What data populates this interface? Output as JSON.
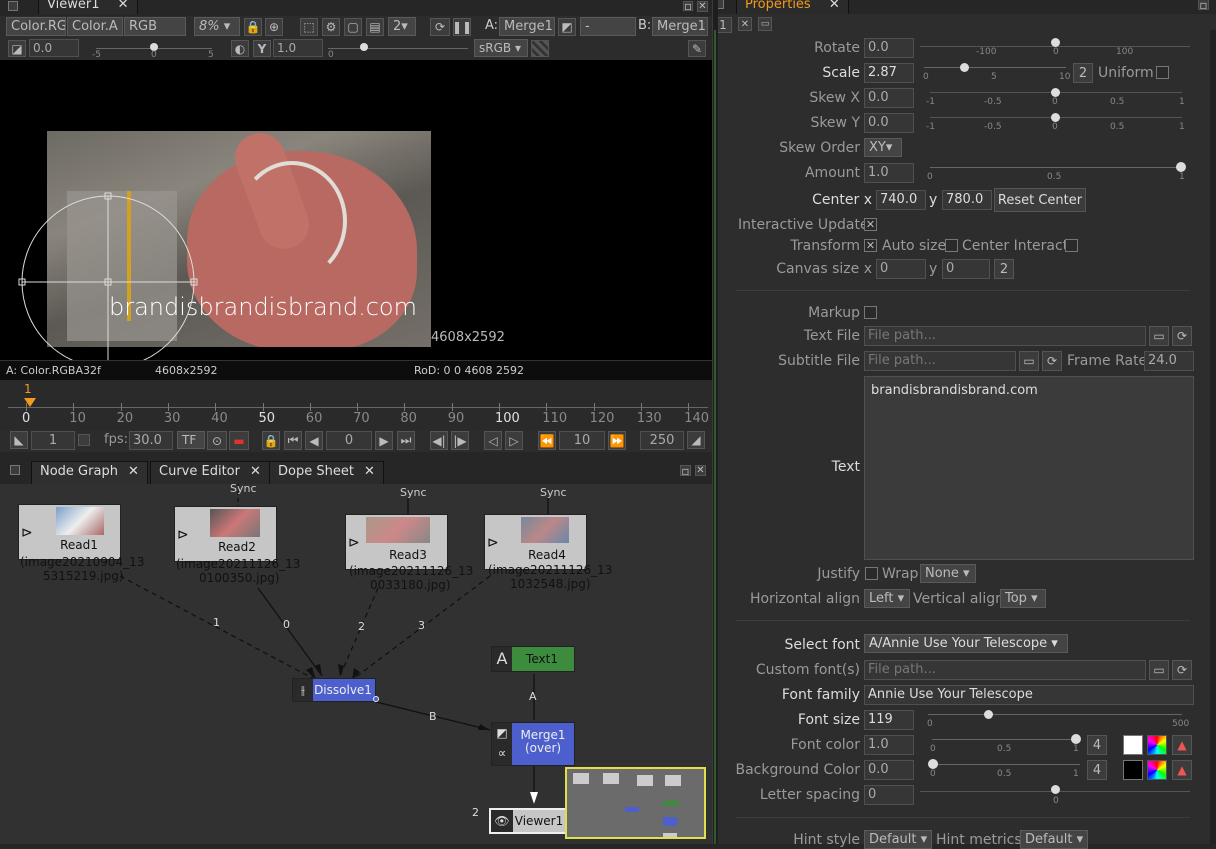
{
  "viewer": {
    "tab": "Viewer1",
    "layer": "Color.RGBA",
    "alpha": "Color.A",
    "channels": "RGB",
    "zoom": "8%",
    "a_label": "A:",
    "a_input": "Merge1",
    "op": "-",
    "b_label": "B:",
    "b_input": "Merge1",
    "proxy": "2",
    "gain": "0.0",
    "gain_ticks": [
      "-5",
      "0",
      "5"
    ],
    "gamma": "1.0",
    "gamma_ticks": [
      "0"
    ],
    "colorspace": "sRGB",
    "overlay_text": "brandisbrandisbrand.com",
    "format": "4608x2592",
    "info_left": "A: Color.RGBA32f",
    "info_format": "4608x2592",
    "info_rod": "RoD: 0 0 4608 2592"
  },
  "timeline": {
    "current_marker": "1",
    "ticks": [
      "0",
      "10",
      "20",
      "30",
      "40",
      "50",
      "60",
      "70",
      "80",
      "90",
      "100",
      "110",
      "120",
      "130",
      "140"
    ],
    "start_frame": "1",
    "fps_label": "fps:",
    "fps": "30.0",
    "tf": "TF",
    "current_frame": "0",
    "step": "10",
    "end_frame": "250"
  },
  "graph_tabs": [
    "Node Graph",
    "Curve Editor",
    "Dope Sheet"
  ],
  "nodes": {
    "read1": [
      "Read1",
      "(image20210904_13",
      "5315219.jpg)"
    ],
    "read2": [
      "Read2",
      "(image20211126_13",
      "0100350.jpg)"
    ],
    "read3": [
      "Read3",
      "(image20211126_13",
      "0033180.jpg)"
    ],
    "read4": [
      "Read4",
      "(image20211126_13",
      "1032548.jpg)"
    ],
    "sync": "Sync",
    "dissolve": "Dissolve1",
    "text": "Text1",
    "merge": [
      "Merge1",
      "(over)"
    ],
    "viewer": "Viewer1",
    "edge_labels": [
      "1",
      "0",
      "2",
      "3",
      "A",
      "B",
      "2"
    ]
  },
  "props": {
    "tab": "Properties",
    "rotate_label": "Rotate",
    "rotate": "0.0",
    "rotate_ticks": [
      "-100",
      "0",
      "100"
    ],
    "scale_label": "Scale",
    "scale": "2.87",
    "scale_ticks": [
      "0",
      "5",
      "10"
    ],
    "scale_dim": "2",
    "uniform": "Uniform",
    "skewx_label": "Skew X",
    "skewx": "0.0",
    "skewy_label": "Skew Y",
    "skewy": "0.0",
    "skew_ticks": [
      "-1",
      "-0.5",
      "0",
      "0.5",
      "1"
    ],
    "skew_order_label": "Skew Order",
    "skew_order": "XY",
    "amount_label": "Amount",
    "amount": "1.0",
    "amount_ticks": [
      "0",
      "0.5",
      "1"
    ],
    "center_label": "Center x",
    "center_x": "740.0",
    "center_y_label": "y",
    "center_y": "780.0",
    "reset_center": "Reset Center",
    "interactive_update": "Interactive Update",
    "transform": "Transform",
    "auto_size": "Auto size",
    "center_interact": "Center Interact",
    "canvas_size": "Canvas size x",
    "canvas_x": "0",
    "canvas_y_label": "y",
    "canvas_y": "0",
    "canvas_dim": "2",
    "markup": "Markup",
    "text_file": "Text File",
    "path_ph": "File path...",
    "subtitle_file": "Subtitle File",
    "frame_rate_label": "Frame Rate",
    "frame_rate": "24.0",
    "text_label": "Text",
    "text_value": "brandisbrandisbrand.com",
    "justify": "Justify",
    "wrap": "Wrap",
    "wrap_value": "None",
    "halign_label": "Horizontal align",
    "halign": "Left",
    "valign_label": "Vertical align",
    "valign": "Top",
    "select_font": "Select font",
    "font": "A/Annie Use Your Telescope",
    "custom_fonts": "Custom font(s)",
    "font_family_label": "Font family",
    "font_family": "Annie Use Your Telescope",
    "font_size_label": "Font size",
    "font_size": "119",
    "font_size_ticks": [
      "0",
      "500"
    ],
    "font_color_label": "Font color",
    "font_color": "1.0",
    "color_ticks": [
      "0",
      "0.5",
      "1"
    ],
    "four": "4",
    "bg_color_label": "Background Color",
    "bg_color": "0.0",
    "letter_spacing_label": "Letter spacing",
    "letter_spacing": "0",
    "letter_ticks": [
      "0"
    ],
    "hint_style": "Hint style",
    "hint_metrics": "Hint metrics",
    "default": "Default"
  }
}
